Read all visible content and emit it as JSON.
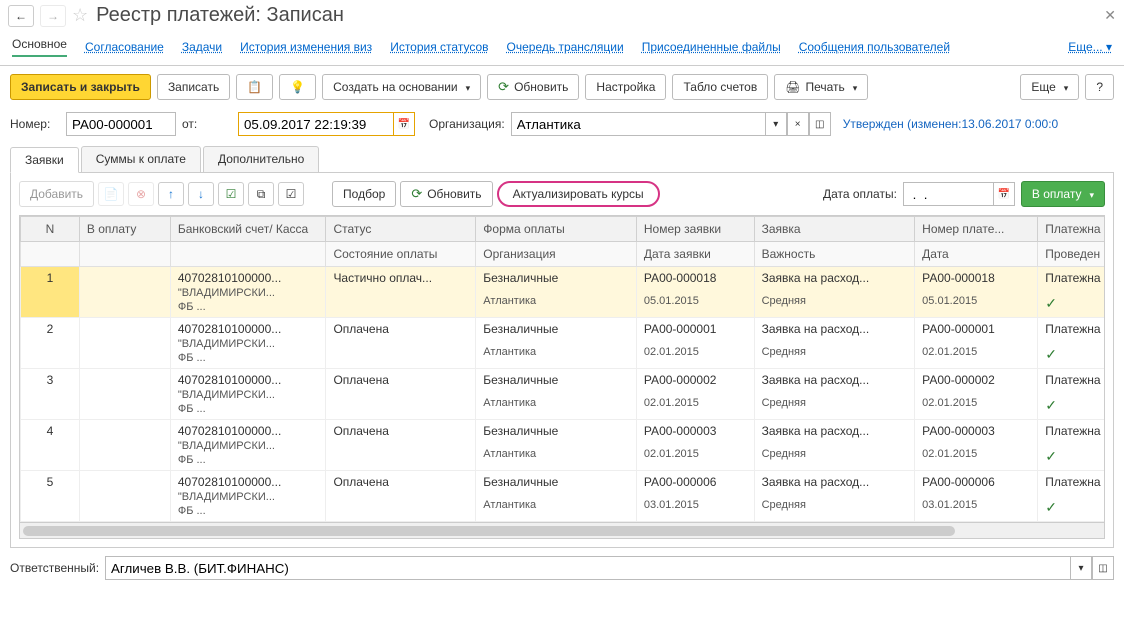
{
  "title": "Реестр платежей: Записан",
  "nav_links": [
    "Основное",
    "Согласование",
    "Задачи",
    "История изменения виз",
    "История статусов",
    "Очередь трансляции",
    "Присоединенные файлы",
    "Сообщения пользователей"
  ],
  "nav_more": "Еще... ▾",
  "toolbar": {
    "save_close": "Записать и закрыть",
    "save": "Записать",
    "create_based": "Создать на основании",
    "refresh": "Обновить",
    "settings": "Настройка",
    "chart": "Табло счетов",
    "print": "Печать",
    "more": "Еще",
    "help": "?"
  },
  "form": {
    "number_label": "Номер:",
    "number_value": "РА00-000001",
    "date_label": "от:",
    "date_value": "05.09.2017 22:19:39",
    "org_label": "Организация:",
    "org_value": "Атлантика",
    "status_text": "Утвержден (изменен:13.06.2017 0:00:0"
  },
  "tabs": [
    "Заявки",
    "Суммы к оплате",
    "Дополнительно"
  ],
  "panel_toolbar": {
    "add": "Добавить",
    "select": "Подбор",
    "refresh": "Обновить",
    "update_rates": "Актуализировать курсы",
    "pay_date_label": "Дата оплаты:",
    "pay_date_value": " .  .    ",
    "to_pay": "В оплату"
  },
  "grid_headers": {
    "n": "N",
    "to_pay": "В оплату",
    "bank": "Банковский счет/ Касса",
    "status": "Статус",
    "form": "Форма оплаты",
    "req_num": "Номер заявки",
    "app": "Заявка",
    "pay_num": "Номер плате...",
    "pl": "Платежна",
    "pay_state": "Состояние оплаты",
    "org": "Организация",
    "req_date": "Дата заявки",
    "importance": "Важность",
    "date": "Дата",
    "posted": "Проведен"
  },
  "rows": [
    {
      "n": "1",
      "bank": "40702810100000...\n\"ВЛАДИМИРСКИ...\nФБ ...",
      "status": "Частично оплач...",
      "form": "Безналичные",
      "req_num": "РА00-000018",
      "app": "Заявка на расход...",
      "pay_num": "РА00-000018",
      "pl": "Платежна",
      "org": "Атлантика",
      "req_date": "05.01.2015",
      "imp": "Средняя",
      "date": "05.01.2015",
      "posted": "✓",
      "selected": true
    },
    {
      "n": "2",
      "bank": "40702810100000...\n\"ВЛАДИМИРСКИ...\nФБ ...",
      "status": "Оплачена",
      "form": "Безналичные",
      "req_num": "РА00-000001",
      "app": "Заявка на расход...",
      "pay_num": "РА00-000001",
      "pl": "Платежна",
      "org": "Атлантика",
      "req_date": "02.01.2015",
      "imp": "Средняя",
      "date": "02.01.2015",
      "posted": "✓"
    },
    {
      "n": "3",
      "bank": "40702810100000...\n\"ВЛАДИМИРСКИ...\nФБ ...",
      "status": "Оплачена",
      "form": "Безналичные",
      "req_num": "РА00-000002",
      "app": "Заявка на расход...",
      "pay_num": "РА00-000002",
      "pl": "Платежна",
      "org": "Атлантика",
      "req_date": "02.01.2015",
      "imp": "Средняя",
      "date": "02.01.2015",
      "posted": "✓"
    },
    {
      "n": "4",
      "bank": "40702810100000...\n\"ВЛАДИМИРСКИ...\nФБ ...",
      "status": "Оплачена",
      "form": "Безналичные",
      "req_num": "РА00-000003",
      "app": "Заявка на расход...",
      "pay_num": "РА00-000003",
      "pl": "Платежна",
      "org": "Атлантика",
      "req_date": "02.01.2015",
      "imp": "Средняя",
      "date": "02.01.2015",
      "posted": "✓"
    },
    {
      "n": "5",
      "bank": "40702810100000...\n\"ВЛАДИМИРСКИ...\nФБ ...",
      "status": "Оплачена",
      "form": "Безналичные",
      "req_num": "РА00-000006",
      "app": "Заявка на расход...",
      "pay_num": "РА00-000006",
      "pl": "Платежна",
      "org": "Атлантика",
      "req_date": "03.01.2015",
      "imp": "Средняя",
      "date": "03.01.2015",
      "posted": "✓"
    }
  ],
  "footer": {
    "resp_label": "Ответственный:",
    "resp_value": "Агличев В.В. (БИТ.ФИНАНС)"
  }
}
